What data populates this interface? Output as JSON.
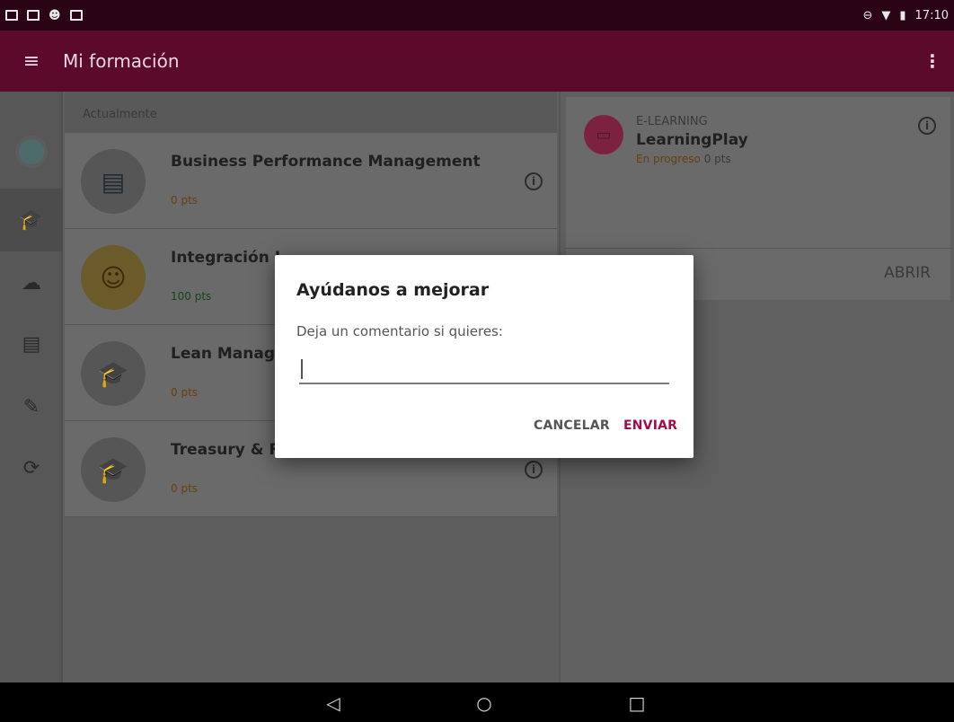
{
  "status_bar": {
    "time": "17:10",
    "icons": [
      "image-icon",
      "gmail-icon",
      "android-icon",
      "clipboard-icon",
      "do-not-disturb-icon",
      "wifi-icon",
      "battery-icon"
    ]
  },
  "toolbar": {
    "title": "Mi formación",
    "menu_icon": "hamburger-icon",
    "overflow_icon": "more-vert-icon"
  },
  "rail": {
    "items": [
      {
        "icon": "avatar-icon"
      },
      {
        "icon": "graduation-cap-icon",
        "active": true
      },
      {
        "icon": "cloud-download-icon"
      },
      {
        "icon": "list-icon"
      },
      {
        "icon": "tools-icon"
      },
      {
        "icon": "sync-icon"
      }
    ]
  },
  "list": {
    "header": "Actualmente",
    "courses": [
      {
        "name": "Business Performance Management",
        "points": "0 pts",
        "icon": "document-thumb"
      },
      {
        "name": "Integración L",
        "points": "100 pts",
        "icon": "smiley-thumb"
      },
      {
        "name": "Lean Manage",
        "points": "0 pts",
        "icon": "graduation-cap-icon"
      },
      {
        "name": "Treasury & Fi",
        "points": "0 pts",
        "icon": "graduation-cap-icon"
      }
    ]
  },
  "detail": {
    "type": "E-LEARNING",
    "name": "LearningPlay",
    "status": "En progreso",
    "points": "0 pts",
    "open_label": "ABRIR"
  },
  "dialog": {
    "title": "Ayúdanos a mejorar",
    "message": "Deja un comentario si quieres:",
    "input_value": "",
    "cancel_label": "CANCELAR",
    "send_label": "ENVIAR"
  },
  "colors": {
    "accent": "#a10c4b",
    "toolbar": "#5b0a2c",
    "status_bar": "#2a0414"
  }
}
